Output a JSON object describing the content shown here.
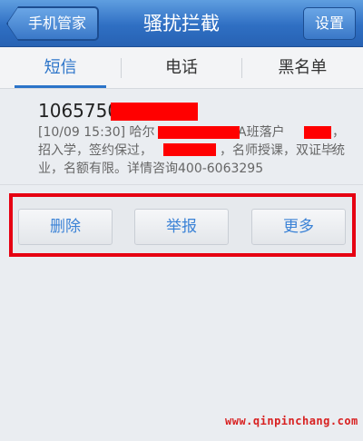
{
  "header": {
    "back_label": "手机管家",
    "title": "骚扰拦截",
    "settings_label": "设置"
  },
  "tabs": [
    {
      "label": "短信"
    },
    {
      "label": "电话"
    },
    {
      "label": "黑名单"
    }
  ],
  "message": {
    "sender": "1065750",
    "line1": "[10/09 15:30] 哈尔",
    "line1b": "A班落户",
    "line1c": "，统",
    "line2a": "招入学，签约保过，",
    "line2b": "，名师授课，双证毕",
    "line3": "业，名额有限。详情咨询400-6063295"
  },
  "actions": {
    "delete_label": "删除",
    "report_label": "举报",
    "more_label": "更多"
  },
  "watermark": "www.qinpinchang.com",
  "colors": {
    "header_blue": "#2f6fc3",
    "accent_blue": "#2b74c9",
    "highlight_red": "#e60012"
  }
}
